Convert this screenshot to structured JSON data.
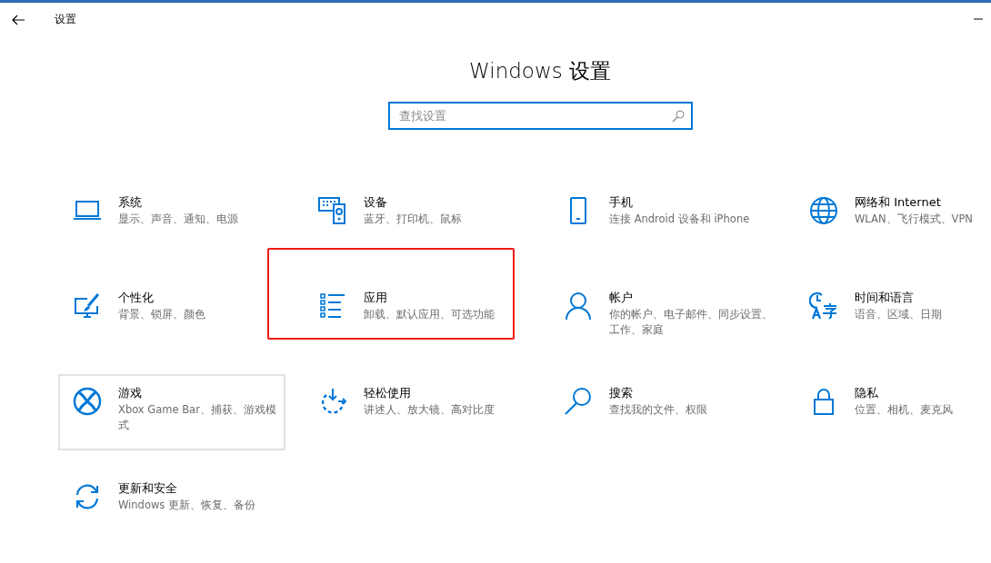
{
  "window": {
    "title": "设置"
  },
  "heading": "Windows 设置",
  "search": {
    "placeholder": "查找设置"
  },
  "tiles": [
    {
      "title": "系统",
      "subtitle": "显示、声音、通知、电源",
      "hovered": false,
      "highlighted": false
    },
    {
      "title": "设备",
      "subtitle": "蓝牙、打印机、鼠标",
      "hovered": false,
      "highlighted": false
    },
    {
      "title": "手机",
      "subtitle": "连接 Android 设备和 iPhone",
      "hovered": false,
      "highlighted": false
    },
    {
      "title": "网络和 Internet",
      "subtitle": "WLAN、飞行模式、VPN",
      "hovered": false,
      "highlighted": false
    },
    {
      "title": "个性化",
      "subtitle": "背景、锁屏、颜色",
      "hovered": false,
      "highlighted": false
    },
    {
      "title": "应用",
      "subtitle": "卸载、默认应用、可选功能",
      "hovered": false,
      "highlighted": true
    },
    {
      "title": "帐户",
      "subtitle": "你的帐户、电子邮件、同步设置、工作、家庭",
      "hovered": false,
      "highlighted": false
    },
    {
      "title": "时间和语言",
      "subtitle": "语音、区域、日期",
      "hovered": false,
      "highlighted": false
    },
    {
      "title": "游戏",
      "subtitle": "Xbox Game Bar、捕获、游戏模式",
      "hovered": true,
      "highlighted": false
    },
    {
      "title": "轻松使用",
      "subtitle": "讲述人、放大镜、高对比度",
      "hovered": false,
      "highlighted": false
    },
    {
      "title": "搜索",
      "subtitle": "查找我的文件、权限",
      "hovered": false,
      "highlighted": false
    },
    {
      "title": "隐私",
      "subtitle": "位置、相机、麦克风",
      "hovered": false,
      "highlighted": false
    },
    {
      "title": "更新和安全",
      "subtitle": "Windows 更新、恢复、备份",
      "hovered": false,
      "highlighted": false
    }
  ]
}
